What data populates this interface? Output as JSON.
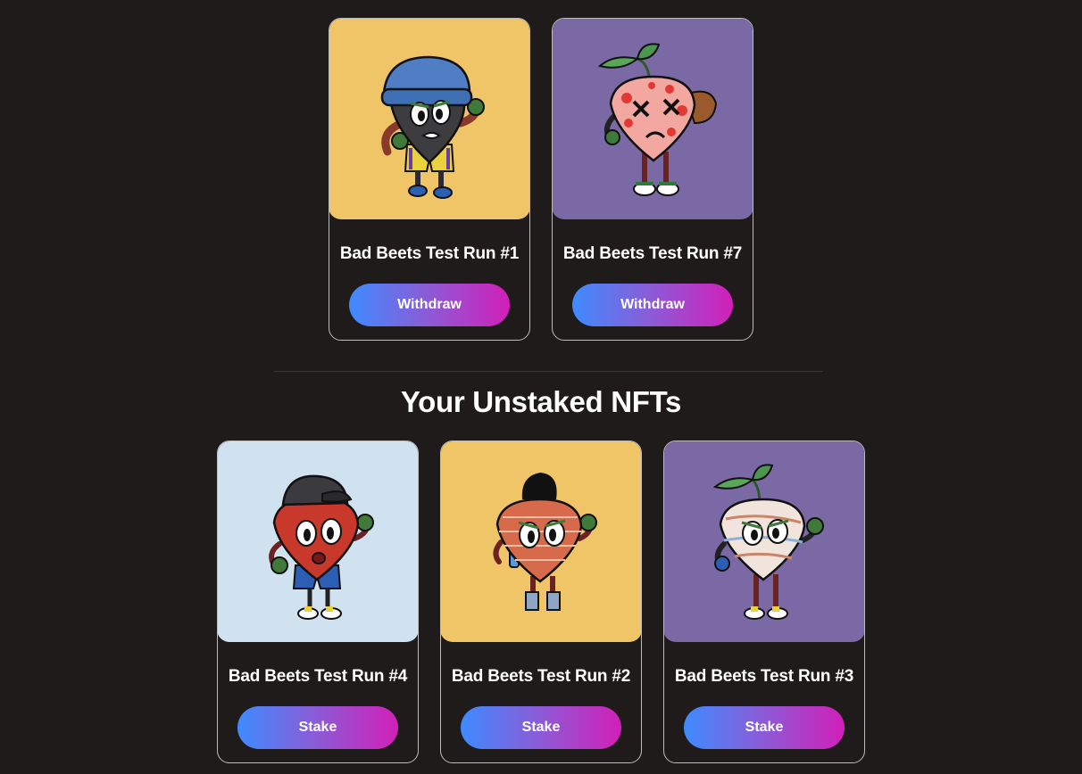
{
  "colors": {
    "page_background": "#1e1b1a",
    "card_border": "#bdbdbd",
    "button_gradient": [
      "#3f8bff",
      "#8d5ad6",
      "#d21fb8"
    ],
    "art_yellow": "#f0c567",
    "art_purple": "#7b69a5",
    "art_lightblue": "#d0e1ef"
  },
  "staked": {
    "cards": [
      {
        "title": "Bad Beets Test Run #1",
        "button": "Withdraw",
        "art_background": "#f0c567",
        "art_icon": "beet-beanie-icon"
      },
      {
        "title": "Bad Beets Test Run #7",
        "button": "Withdraw",
        "art_background": "#7b69a5",
        "art_icon": "beet-spotted-icon"
      }
    ]
  },
  "unstaked": {
    "heading": "Your Unstaked NFTs",
    "cards": [
      {
        "title": "Bad Beets Test Run #4",
        "button": "Stake",
        "art_background": "#d0e1ef",
        "art_icon": "beet-cap-icon"
      },
      {
        "title": "Bad Beets Test Run #2",
        "button": "Stake",
        "art_background": "#f0c567",
        "art_icon": "beet-brick-icon"
      },
      {
        "title": "Bad Beets Test Run #3",
        "button": "Stake",
        "art_background": "#7b69a5",
        "art_icon": "beet-marble-icon"
      }
    ]
  }
}
